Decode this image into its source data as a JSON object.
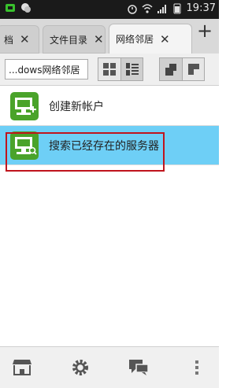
{
  "status_bar": {
    "left_icons": [
      "notification-icon",
      "wechat-icon"
    ],
    "right_icons": [
      "alarm-icon",
      "wifi-icon",
      "signal-icon",
      "battery-icon"
    ],
    "time": "19:37"
  },
  "tabs": [
    {
      "label": "档",
      "closable": true,
      "active": false
    },
    {
      "label": "文件目录",
      "closable": true,
      "active": false
    },
    {
      "label": "网络邻居",
      "closable": true,
      "active": true
    }
  ],
  "tab_close_glyph": "✕",
  "add_tab_glyph": "+",
  "toolbar": {
    "path": "...dows网络邻居",
    "view_buttons": [
      "grid-view-icon",
      "list-view-icon"
    ],
    "window_buttons": [
      "window-1-icon",
      "window-2-icon"
    ]
  },
  "list": [
    {
      "label": "创建新帐户",
      "icon": "add-account-icon",
      "selected": false
    },
    {
      "label": "搜索已经存在的服务器",
      "icon": "search-server-icon",
      "selected": true
    }
  ],
  "colors": {
    "accent_green": "#4aa32a",
    "selected_blue": "#6ecff6",
    "highlight_red": "#c0141c"
  },
  "bottom_bar": [
    "store-icon",
    "settings-icon",
    "messages-icon",
    "more-icon"
  ]
}
